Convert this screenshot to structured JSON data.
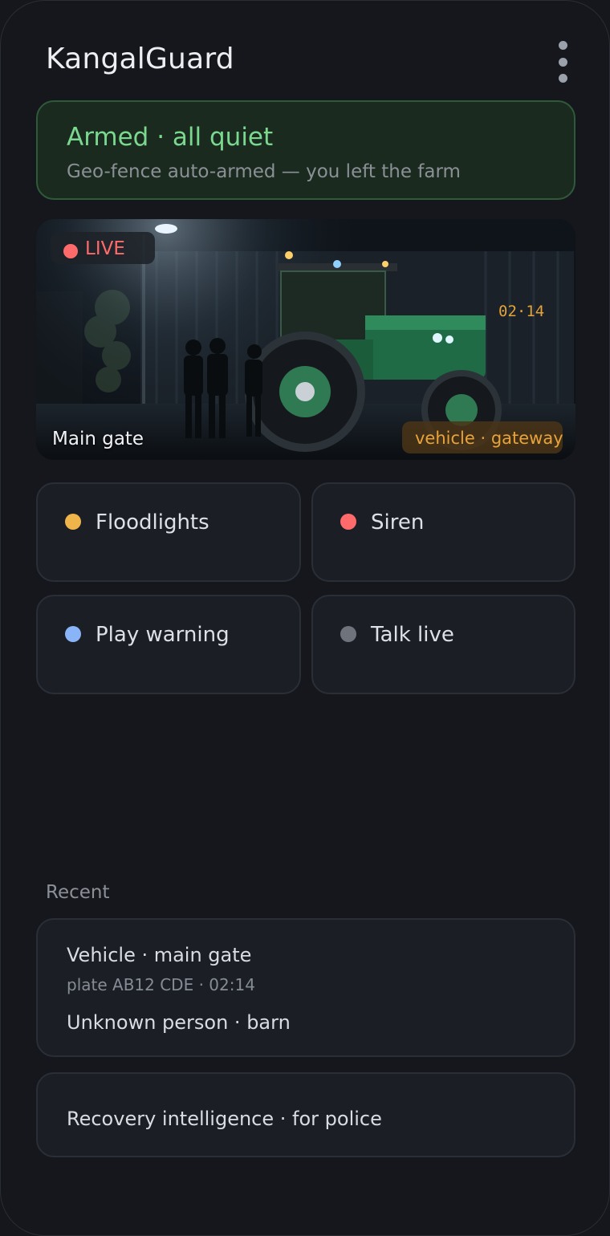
{
  "app": {
    "title": "KangalGuard",
    "menu_icon": "more-vertical-icon"
  },
  "status": {
    "title": "Armed · all quiet",
    "subtitle": "Geo-fence auto-armed — you left the farm",
    "color": "#7bd88f"
  },
  "camera": {
    "live_label": "LIVE",
    "name": "Main gate",
    "detection_tag": "vehicle · gateway",
    "overlay_time": "02·14"
  },
  "actions": [
    {
      "label": "Floodlights",
      "dot_color": "#f0b54a"
    },
    {
      "label": "Siren",
      "dot_color": "#ff6b6b"
    },
    {
      "label": "Play warning",
      "dot_color": "#8ab4f8"
    },
    {
      "label": "Talk live",
      "dot_color": "#6e737c"
    }
  ],
  "recent": {
    "heading": "Recent",
    "events": [
      {
        "title": "Vehicle · main gate",
        "detail": "plate AB12 CDE · 02:14"
      },
      {
        "title": "Unknown person · barn"
      }
    ],
    "recovery_label": "Recovery intelligence · for police"
  }
}
